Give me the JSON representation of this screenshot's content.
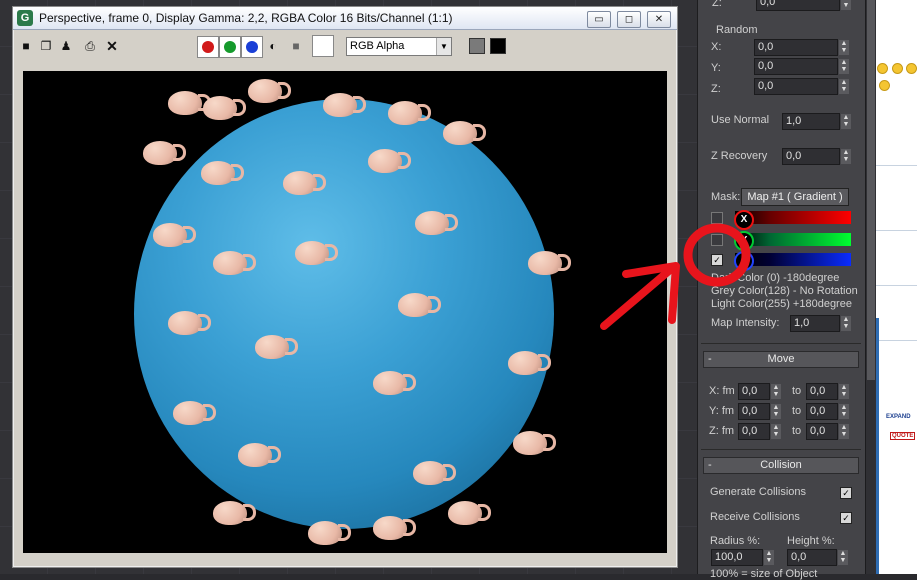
{
  "render_window": {
    "title": "Perspective, frame 0, Display Gamma: 2,2, RGBA Color 16 Bits/Channel (1:1)",
    "app_icon_letter": "G",
    "controls": {
      "minimize": "▭",
      "maximize": "◻",
      "close": "✕"
    },
    "channel_select": "RGB Alpha",
    "channel_colors": {
      "red": "#d11a1a",
      "green": "#159a2c",
      "blue": "#1a3fd6"
    }
  },
  "params": {
    "z_top": {
      "label": "Z:",
      "value": "0,0"
    },
    "random_title": "Random",
    "random_x": {
      "label": "X:",
      "value": "0,0"
    },
    "random_y": {
      "label": "Y:",
      "value": "0,0"
    },
    "random_z": {
      "label": "Z:",
      "value": "0,0"
    },
    "use_normal": {
      "label": "Use Normal",
      "value": "1,0"
    },
    "z_recovery": {
      "label": "Z Recovery",
      "value": "0,0"
    },
    "mask_label": "Mask:",
    "mask_map": "Map #1  ( Gradient )",
    "axes": [
      "X",
      "Y",
      "Z"
    ],
    "dark_color": "Dark Color (0)    -180degree",
    "grey_color": "Grey Color(128) - No Rotation",
    "light_color": "Light Color(255)  +180degree",
    "map_intensity": {
      "label": "Map Intensity:",
      "value": "1,0"
    }
  },
  "move": {
    "title": "Move",
    "rows": [
      {
        "axis": "X: fm",
        "from": "0,0",
        "to_label": "to",
        "to": "0,0"
      },
      {
        "axis": "Y: fm",
        "from": "0,0",
        "to_label": "to",
        "to": "0,0"
      },
      {
        "axis": "Z: fm",
        "from": "0,0",
        "to_label": "to",
        "to": "0,0"
      }
    ]
  },
  "collision": {
    "title": "Collision",
    "generate": {
      "label": "Generate Collisions",
      "checked": true
    },
    "receive": {
      "label": "Receive Collisions",
      "checked": true
    },
    "radius_label": "Radius %:",
    "height_label": "Height %:",
    "radius_value": "100,0",
    "height_value": "0,0",
    "footer": "100% = size of Object"
  },
  "browser": {
    "expand_text": "EXPAND",
    "quote_text": "QUOTE"
  },
  "annotation_color": "#e8141c"
}
